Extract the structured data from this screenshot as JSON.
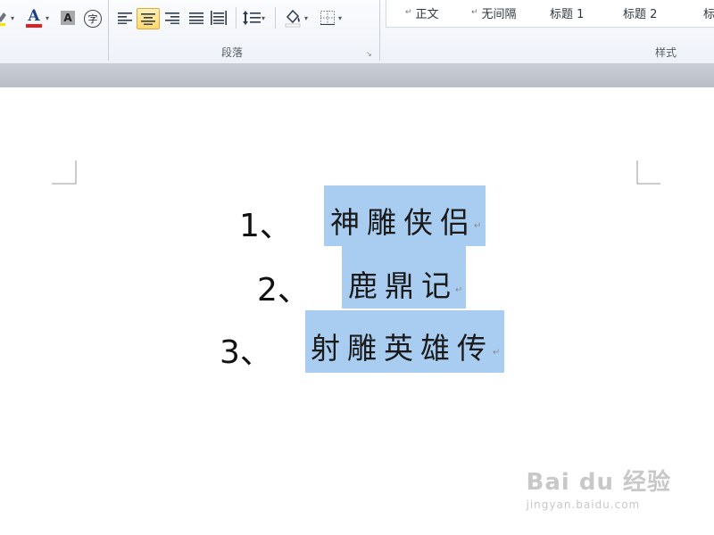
{
  "ribbon": {
    "font_tools": {
      "highlight_icon": "highlight-pen-icon",
      "font_color_glyph": "A",
      "font_color": "#e02020",
      "char_shading_glyph": "A",
      "enclose_char_glyph": "字"
    },
    "paragraph": {
      "label": "段落",
      "align_buttons": [
        {
          "name": "align-left-icon"
        },
        {
          "name": "align-center-icon",
          "active": true
        },
        {
          "name": "align-right-icon"
        },
        {
          "name": "justify-icon"
        },
        {
          "name": "distributed-icon"
        }
      ]
    },
    "styles": {
      "label": "样式",
      "items": [
        {
          "label": "正文",
          "mark": "↵"
        },
        {
          "label": "无间隔",
          "mark": "↵"
        },
        {
          "label": "标题 1",
          "mark": ""
        },
        {
          "label": "标题 2",
          "mark": ""
        },
        {
          "label": "标",
          "mark": ""
        }
      ]
    }
  },
  "document": {
    "list": [
      {
        "num": "1、",
        "text": "神雕侠侣",
        "mark": "↵"
      },
      {
        "num": "2、",
        "text": "鹿鼎记",
        "mark": "↵"
      },
      {
        "num": "3、",
        "text": "射雕英雄传",
        "mark": "↵"
      }
    ],
    "selection_color": "#a8cdf0"
  },
  "watermark": {
    "main": "Bai du 经验",
    "sub": "jingyan.baidu.com"
  }
}
